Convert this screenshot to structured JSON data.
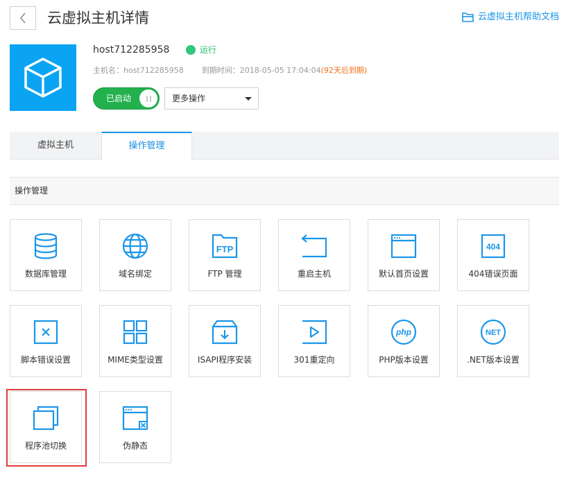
{
  "header": {
    "back_icon": "chevron-left-icon",
    "title": "云虚拟主机详情",
    "help_icon": "folder-icon",
    "help_link": "云虚拟主机帮助文档"
  },
  "host": {
    "logo_icon": "cube-icon",
    "name": "host712285958",
    "status": "运行",
    "status_color": "#2fc878",
    "hostname_label": "主机名：",
    "hostname": "host712285958",
    "expire_label": "到期时间：",
    "expire_time": "2018-05-05 17:04:04",
    "expire_remaining": "(92天后到期)",
    "toggle_label": "已启动",
    "more_ops": "更多操作"
  },
  "tabs": [
    {
      "label": "虚拟主机",
      "active": false
    },
    {
      "label": "操作管理",
      "active": true
    }
  ],
  "section_title": "操作管理",
  "accent_color": "#1a96e8",
  "tiles": [
    {
      "label": "数据库管理",
      "icon": "database-icon"
    },
    {
      "label": "域名绑定",
      "icon": "globe-icon"
    },
    {
      "label": "FTP 管理",
      "icon": "ftp-folder-icon",
      "icon_text": "FTP"
    },
    {
      "label": "重启主机",
      "icon": "restart-icon"
    },
    {
      "label": "默认首页设置",
      "icon": "browser-window-icon"
    },
    {
      "label": "404错误页面",
      "icon": "error-404-icon",
      "icon_text": "404"
    },
    {
      "label": "脚本错误设置",
      "icon": "close-box-icon"
    },
    {
      "label": "MIME类型设置",
      "icon": "grid-icon"
    },
    {
      "label": "ISAPI程序安装",
      "icon": "download-box-icon"
    },
    {
      "label": "301重定向",
      "icon": "redirect-play-icon"
    },
    {
      "label": "PHP版本设置",
      "icon": "php-icon",
      "icon_text": "php"
    },
    {
      "label": ".NET版本设置",
      "icon": "dotnet-icon",
      "icon_text": "NET"
    },
    {
      "label": "程序池切换",
      "icon": "stacked-windows-icon"
    },
    {
      "label": "伪静态",
      "icon": "window-close-icon"
    }
  ]
}
